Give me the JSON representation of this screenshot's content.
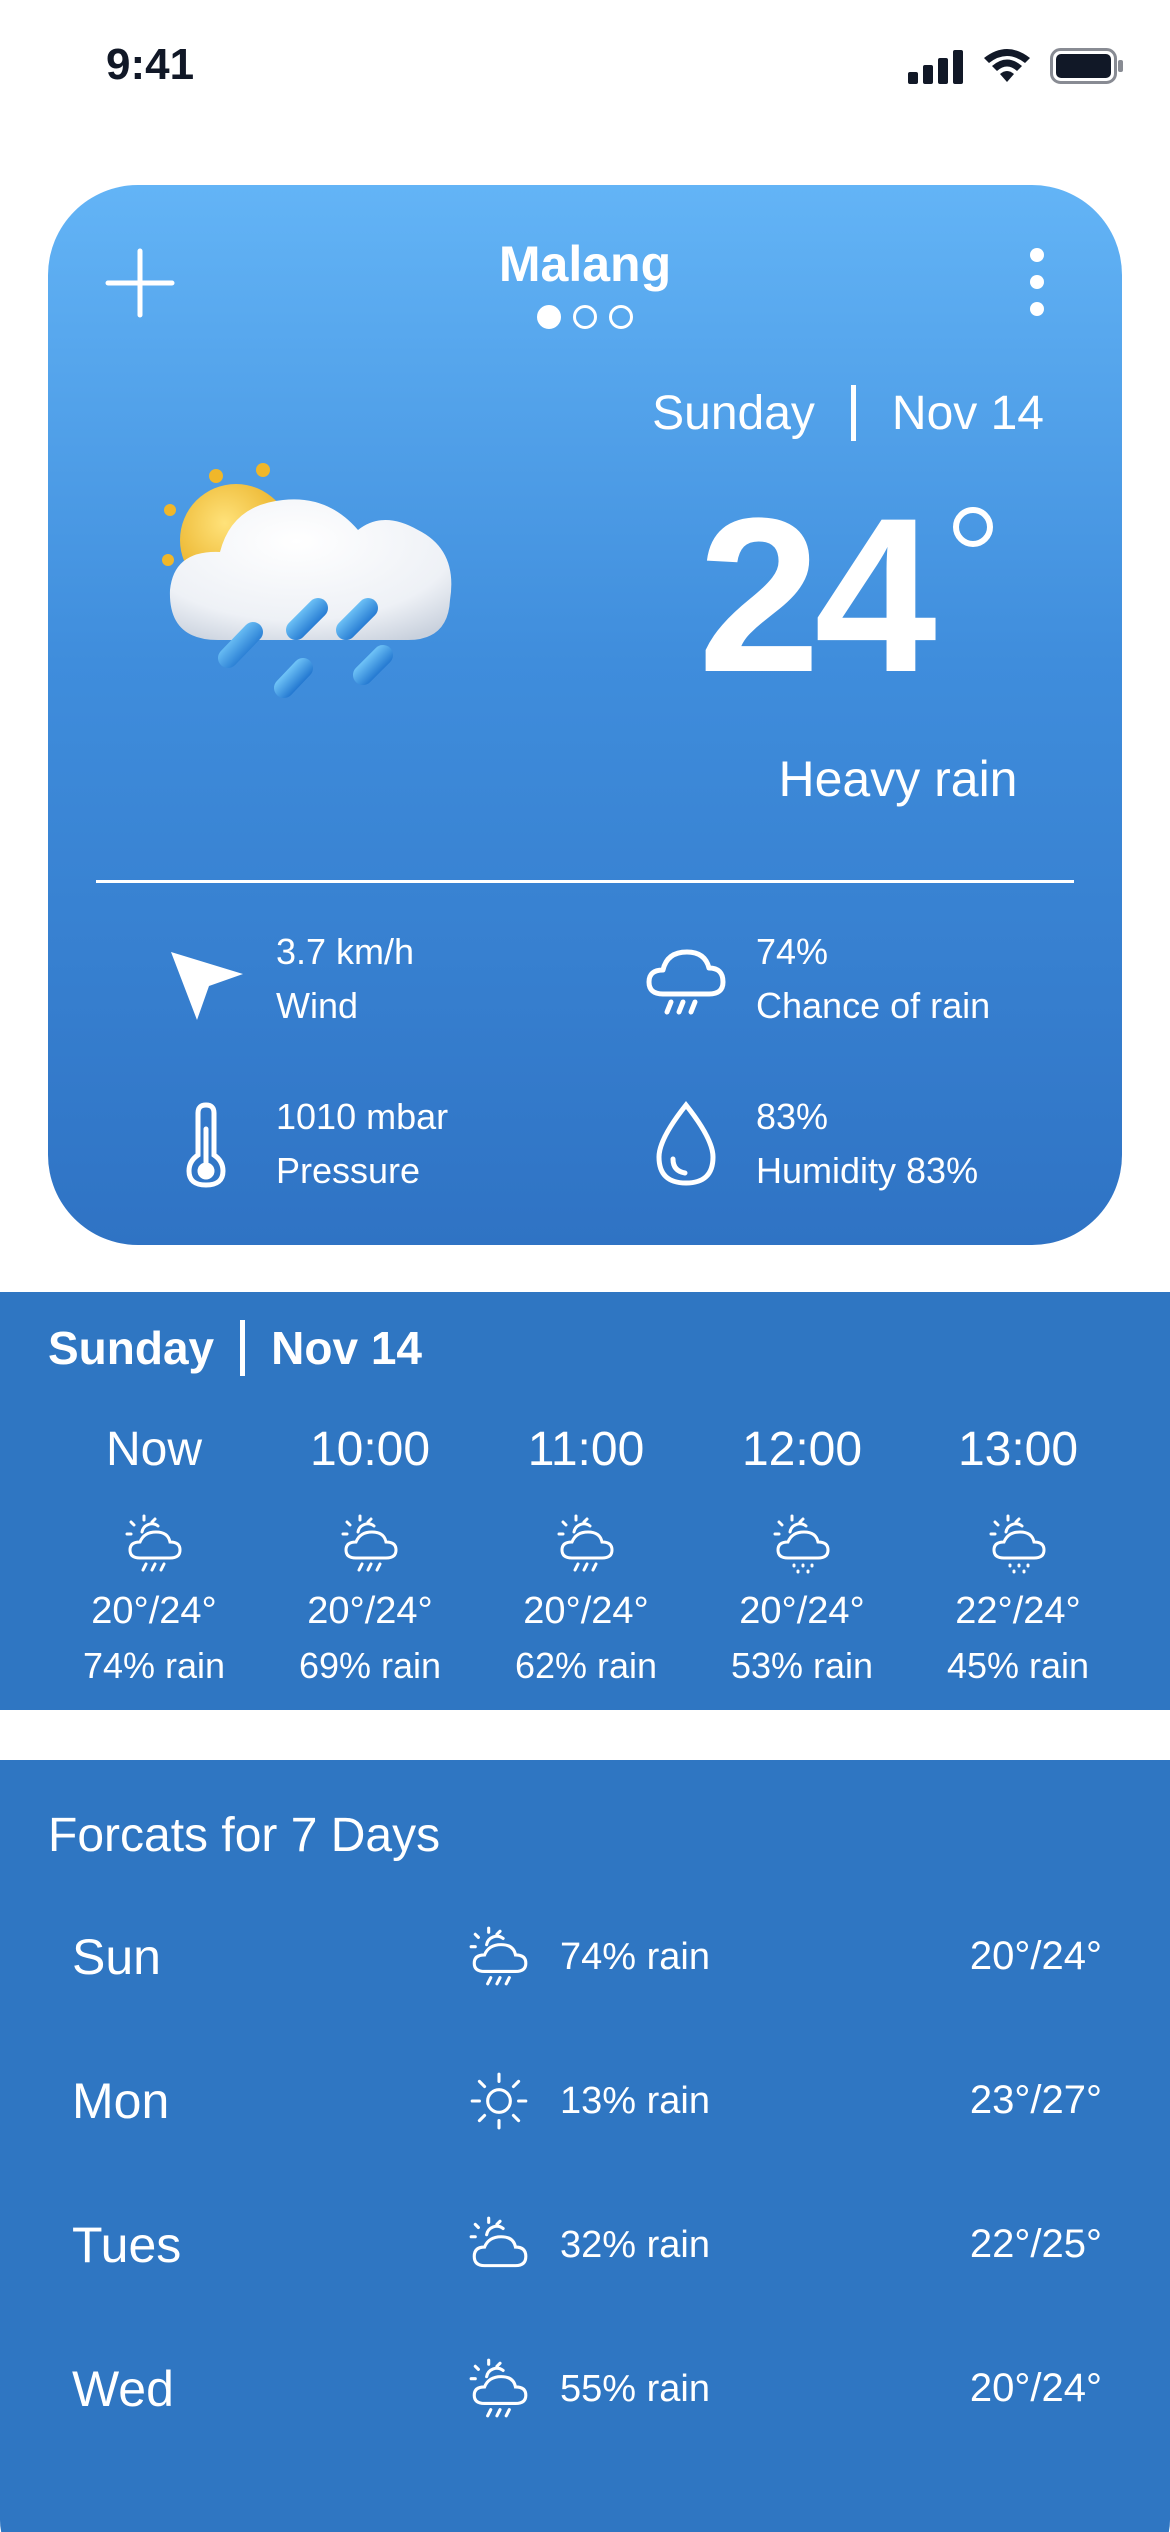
{
  "status_bar": {
    "time": "9:41"
  },
  "current": {
    "location": "Malang",
    "day": "Sunday",
    "date": "Nov 14",
    "temperature": "24",
    "condition": "Heavy rain",
    "stats": {
      "wind_value": "3.7 km/h",
      "wind_label": "Wind",
      "rain_value": "74%",
      "rain_label": "Chance of rain",
      "pressure_value": "1010 mbar",
      "pressure_label": "Pressure",
      "humidity_value": "83%",
      "humidity_label": "Humidity 83%"
    },
    "page_indicator": {
      "pages": 3,
      "active": 1
    }
  },
  "hourly": {
    "day": "Sunday",
    "date": "Nov 14",
    "items": [
      {
        "time": "Now",
        "temp": "20°/24°",
        "rain": "74% rain",
        "icon": "sun-cloud-rain-icon"
      },
      {
        "time": "10:00",
        "temp": "20°/24°",
        "rain": "69% rain",
        "icon": "sun-cloud-rain-icon"
      },
      {
        "time": "11:00",
        "temp": "20°/24°",
        "rain": "62% rain",
        "icon": "sun-cloud-rain-icon"
      },
      {
        "time": "12:00",
        "temp": "20°/24°",
        "rain": "53% rain",
        "icon": "sun-cloud-drizzle-icon"
      },
      {
        "time": "13:00",
        "temp": "22°/24°",
        "rain": "45% rain",
        "icon": "sun-cloud-drizzle-icon"
      }
    ]
  },
  "forecast": {
    "title": "Forcats for 7 Days",
    "days": [
      {
        "day": "Sun",
        "rain": "74% rain",
        "temp": "20°/24°",
        "icon": "sun-cloud-rain-icon"
      },
      {
        "day": "Mon",
        "rain": "13% rain",
        "temp": "23°/27°",
        "icon": "sun-icon"
      },
      {
        "day": "Tues",
        "rain": "32% rain",
        "temp": "22°/25°",
        "icon": "sun-cloud-icon"
      },
      {
        "day": "Wed",
        "rain": "55% rain",
        "temp": "20°/24°",
        "icon": "sun-cloud-rain-icon"
      }
    ]
  }
}
